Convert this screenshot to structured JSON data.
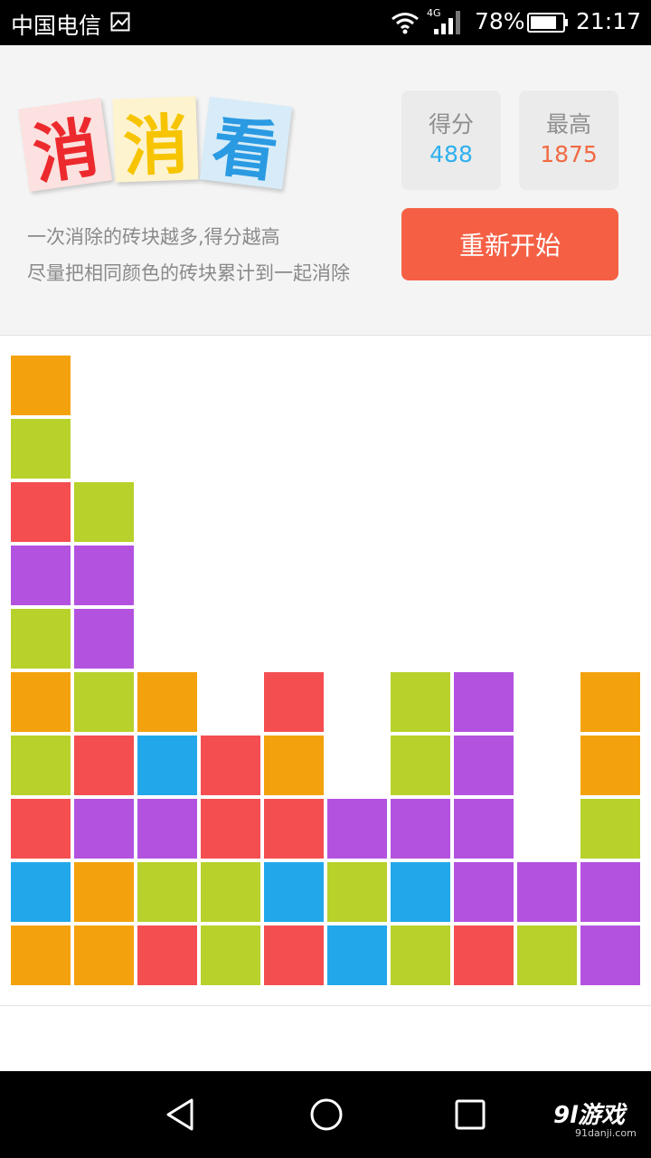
{
  "status_bar": {
    "carrier": "中国电信",
    "network": "4G",
    "battery": "78%",
    "time": "21:17"
  },
  "logo": {
    "chars": [
      "消",
      "消",
      "看"
    ],
    "colors": [
      "#ec2a2e",
      "#f6c400",
      "#2a9ae2"
    ]
  },
  "tagline": {
    "line1": "一次消除的砖块越多,得分越高",
    "line2": "尽量把相同颜色的砖块累计到一起消除"
  },
  "score": {
    "label": "得分",
    "value": "488"
  },
  "best": {
    "label": "最高",
    "value": "1875"
  },
  "restart_label": "重新开始",
  "board": {
    "colors": {
      "O": "#f3a20d",
      "G": "#b8d12b",
      "R": "#f44e51",
      "P": "#b452e0",
      "B": "#22a8ea"
    },
    "rows": [
      "O.........",
      "G.........",
      "RG........",
      "PP........",
      "GP........",
      "OGO.R.GP.O",
      "GRBRO.GP.O",
      "RPPRRPPP.G",
      "BOGGBGBPPP",
      "OORGRBGRGP"
    ]
  },
  "watermark": {
    "brand": "9l游戏",
    "site": "91danji.com"
  }
}
